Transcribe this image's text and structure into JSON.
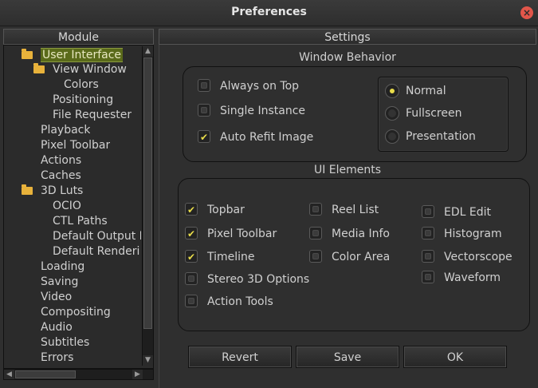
{
  "window": {
    "title": "Preferences"
  },
  "module_header": "Module",
  "settings_header": "Settings",
  "tree": [
    {
      "label": "User Interface",
      "selected": true,
      "folder": true
    },
    {
      "label": "View Window",
      "folder": true
    },
    {
      "label": "Colors"
    },
    {
      "label": "Positioning"
    },
    {
      "label": "File Requester"
    },
    {
      "label": "Playback"
    },
    {
      "label": "Pixel Toolbar"
    },
    {
      "label": "Actions"
    },
    {
      "label": "Caches"
    },
    {
      "label": "3D Luts",
      "folder": true
    },
    {
      "label": "OCIO"
    },
    {
      "label": "CTL Paths"
    },
    {
      "label": "Default Output D"
    },
    {
      "label": "Default Renderi"
    },
    {
      "label": "Loading"
    },
    {
      "label": "Saving"
    },
    {
      "label": "Video"
    },
    {
      "label": "Compositing"
    },
    {
      "label": "Audio"
    },
    {
      "label": "Subtitles"
    },
    {
      "label": "Errors"
    }
  ],
  "window_behavior": {
    "title": "Window Behavior",
    "checkboxes": [
      {
        "label": "Always on Top",
        "checked": false
      },
      {
        "label": "Single Instance",
        "checked": false
      },
      {
        "label": "Auto Refit Image",
        "checked": true
      }
    ],
    "radios": [
      {
        "label": "Normal",
        "selected": true
      },
      {
        "label": "Fullscreen",
        "selected": false
      },
      {
        "label": "Presentation",
        "selected": false
      }
    ]
  },
  "ui_elements": {
    "title": "UI Elements",
    "col1": [
      {
        "label": "Topbar",
        "checked": true
      },
      {
        "label": "Pixel Toolbar",
        "checked": true
      },
      {
        "label": "Timeline",
        "checked": true
      },
      {
        "label": "Stereo 3D Options",
        "checked": false
      },
      {
        "label": "Action Tools",
        "checked": false
      }
    ],
    "col2": [
      {
        "label": "Reel List",
        "checked": false
      },
      {
        "label": "Media Info",
        "checked": false
      },
      {
        "label": "Color Area",
        "checked": false
      }
    ],
    "col3": [
      {
        "label": "EDL Edit",
        "checked": false
      },
      {
        "label": "Histogram",
        "checked": false
      },
      {
        "label": "Vectorscope",
        "checked": false
      },
      {
        "label": "Waveform",
        "checked": false
      }
    ]
  },
  "buttons": {
    "revert": "Revert",
    "save": "Save",
    "ok": "OK"
  },
  "colors": {
    "accent": "#e8dc4a",
    "selection": "#5a6a1a",
    "folder": "#e8b23b",
    "close": "#e2564a"
  }
}
